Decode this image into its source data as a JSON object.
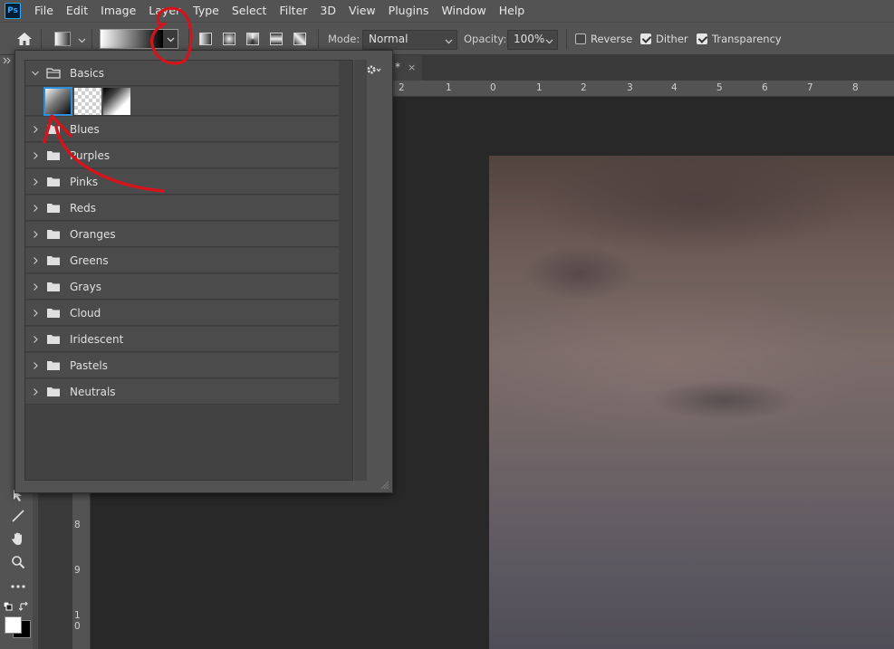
{
  "app": {
    "logo_text": "Ps"
  },
  "menubar": {
    "items": [
      "File",
      "Edit",
      "Image",
      "Layer",
      "Type",
      "Select",
      "Filter",
      "3D",
      "View",
      "Plugins",
      "Window",
      "Help"
    ]
  },
  "options": {
    "mode_label": "Mode:",
    "mode_value": "Normal",
    "opacity_label": "Opacity:",
    "opacity_value": "100%",
    "reverse_label": "Reverse",
    "reverse_checked": false,
    "dither_label": "Dither",
    "dither_checked": true,
    "transparency_label": "Transparency",
    "transparency_checked": true
  },
  "document": {
    "tab_title": "*",
    "close_label": "×"
  },
  "ruler": {
    "top_ticks": [
      "2",
      "1",
      "0",
      "1",
      "2",
      "3",
      "4",
      "5",
      "6",
      "7",
      "8"
    ],
    "left_ticks": [
      "8",
      "9",
      "1\n0"
    ]
  },
  "gradient_panel": {
    "folders": [
      {
        "name": "Basics",
        "expanded": true
      },
      {
        "name": "Blues",
        "expanded": false
      },
      {
        "name": "Purples",
        "expanded": false
      },
      {
        "name": "Pinks",
        "expanded": false
      },
      {
        "name": "Reds",
        "expanded": false
      },
      {
        "name": "Oranges",
        "expanded": false
      },
      {
        "name": "Greens",
        "expanded": false
      },
      {
        "name": "Grays",
        "expanded": false
      },
      {
        "name": "Cloud",
        "expanded": false
      },
      {
        "name": "Iridescent",
        "expanded": false
      },
      {
        "name": "Pastels",
        "expanded": false
      },
      {
        "name": "Neutrals",
        "expanded": false
      }
    ],
    "basics_presets": [
      "foreground-to-background",
      "foreground-to-transparent",
      "black-white"
    ],
    "selected_preset": "foreground-to-background"
  },
  "colors": {
    "annotation": "#d4141c",
    "selection": "#2e8ede",
    "chrome": "#535353"
  }
}
